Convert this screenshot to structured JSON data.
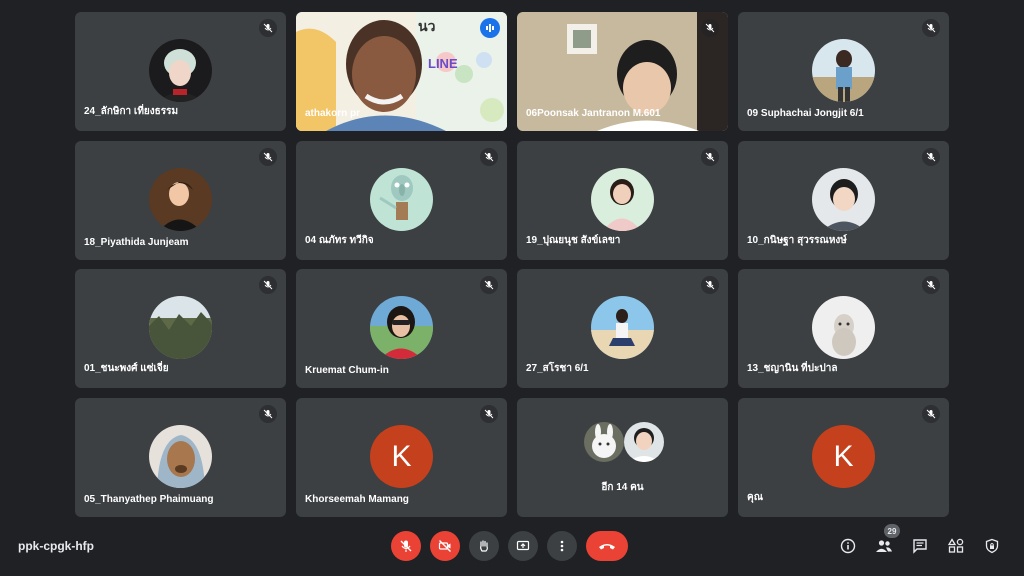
{
  "meeting": {
    "code": "ppk-cpgk-hfp"
  },
  "participants": [
    {
      "name": "24_ลักษิกา เที่ยงธรรม"
    },
    {
      "name": "athakorn pr"
    },
    {
      "name": "06Poonsak Jantranon M.601"
    },
    {
      "name": "09 Suphachai Jongjit 6/1"
    },
    {
      "name": "18_Piyathida Junjeam"
    },
    {
      "name": "04 ณภัทร ทวีกิจ"
    },
    {
      "name": "19_ปุณยนุช สังข์เลขา"
    },
    {
      "name": "10_กนิษฐา สุวรรณหงษ์"
    },
    {
      "name": "01_ชนะพงศ์ แซ่เจี่ย"
    },
    {
      "name": "Kruemat Chum-in"
    },
    {
      "name": "27_สโรชา 6/1"
    },
    {
      "name": "13_ชญานิน ที่ปะปาล"
    },
    {
      "name": "05_Thanyathep Phaimuang"
    },
    {
      "name": "Khorseemah Mamang",
      "initial": "K"
    },
    {
      "name": "อีก 14 คน"
    },
    {
      "name": "คุณ",
      "initial": "K"
    }
  ],
  "video_overlay": {
    "letters": "นว",
    "line_word": "LINE"
  },
  "people_count": "29",
  "colors": {
    "end_call": "#ea4335",
    "avatar_k": "#c5401c",
    "active_outline": "#8ab4f8"
  }
}
